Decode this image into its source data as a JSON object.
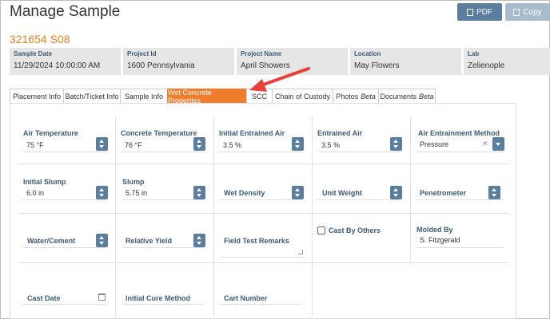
{
  "header": {
    "title": "Manage Sample",
    "pdf_label": "PDF",
    "copy_label": "Copy"
  },
  "sample_id": "321654 S08",
  "info": [
    {
      "label": "Sample Date",
      "value": "11/29/2024 10:00:00 AM"
    },
    {
      "label": "Project Id",
      "value": "1600 Pennsylvania"
    },
    {
      "label": "Project Name",
      "value": "April Showers"
    },
    {
      "label": "Location",
      "value": "May Flowers"
    },
    {
      "label": "Lab",
      "value": "Zelienople"
    }
  ],
  "tabs": [
    {
      "label": "Placement Info"
    },
    {
      "label": "Batch/Ticket Info"
    },
    {
      "label": "Sample Info"
    },
    {
      "label": "Wet Concrete Properties",
      "active": true
    },
    {
      "label": "SCC"
    },
    {
      "label": "Chain of Custody"
    },
    {
      "label": "Photos",
      "beta": "Beta"
    },
    {
      "label": "Documents",
      "beta": "Beta"
    }
  ],
  "fields": {
    "air_temperature": {
      "label": "Air Temperature",
      "value": "75 °F"
    },
    "concrete_temperature": {
      "label": "Concrete Temperature",
      "value": "76 °F"
    },
    "initial_entrained_air": {
      "label": "Initial Entrained Air",
      "value": "3.5 %"
    },
    "entrained_air": {
      "label": "Entrained Air",
      "value": "3.5 %"
    },
    "air_entrainment_method": {
      "label": "Air Entrainment Method",
      "value": "Pressure",
      "clear": "×"
    },
    "initial_slump": {
      "label": "Initial Slump",
      "value": "6.0 in"
    },
    "slump": {
      "label": "Slump",
      "value": "5.75 in"
    },
    "wet_density": {
      "label": "Wet Density",
      "value": ""
    },
    "unit_weight": {
      "label": "Unit Weight",
      "value": ""
    },
    "penetrometer": {
      "label": "Penetrometer",
      "value": ""
    },
    "water_cement": {
      "label": "Water/Cement",
      "value": ""
    },
    "relative_yield": {
      "label": "Relative Yield",
      "value": ""
    },
    "field_test_remarks": {
      "label": "Field Test Remarks",
      "value": ""
    },
    "cast_by_others": {
      "label": "Cast By Others",
      "checked": false
    },
    "molded_by": {
      "label": "Molded By",
      "value": "S. Fitzgerald"
    },
    "cast_date": {
      "label": "Cast Date",
      "value": ""
    },
    "initial_cure_method": {
      "label": "Initial Cure Method",
      "value": ""
    },
    "cart_number": {
      "label": "Cart Number",
      "value": ""
    }
  },
  "annotation": {
    "color": "#e8403a"
  }
}
